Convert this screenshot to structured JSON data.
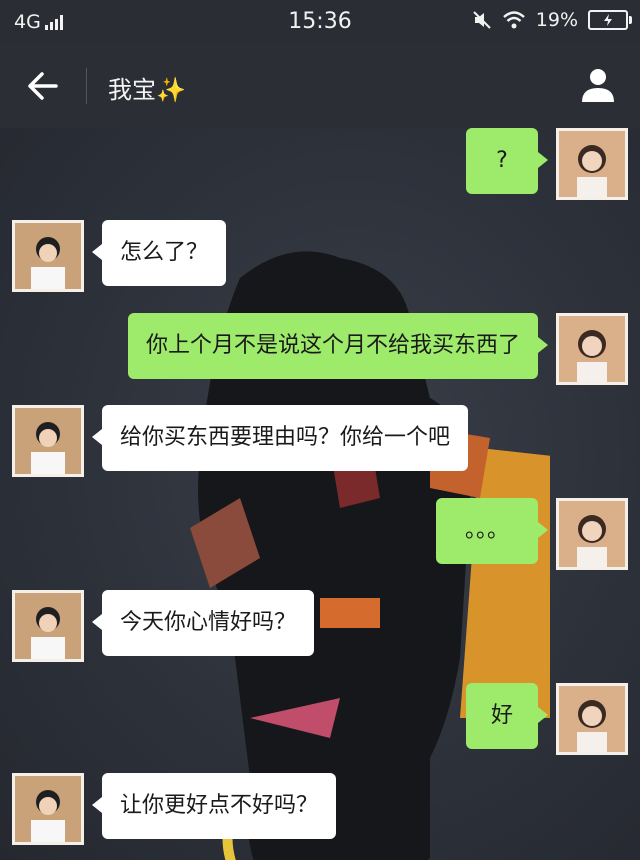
{
  "status": {
    "network": "4G",
    "time": "15:36",
    "battery": "19%"
  },
  "header": {
    "title": "我宝✨"
  },
  "messages": [
    {
      "from": "me",
      "text": "?"
    },
    {
      "from": "them",
      "text": "怎么了？"
    },
    {
      "from": "me",
      "text": "你上个月不是说这个月不给我买东西了"
    },
    {
      "from": "them",
      "text": "给你买东西要理由吗？你给一个吧"
    },
    {
      "from": "me",
      "text": "。。。"
    },
    {
      "from": "them",
      "text": "今天你心情好吗？"
    },
    {
      "from": "me",
      "text": "好"
    },
    {
      "from": "them",
      "text": "让你更好点不好吗？"
    }
  ],
  "colors": {
    "my_bubble": "#9eea6a",
    "their_bubble": "#ffffff",
    "header_bg": "#2b2e34"
  }
}
